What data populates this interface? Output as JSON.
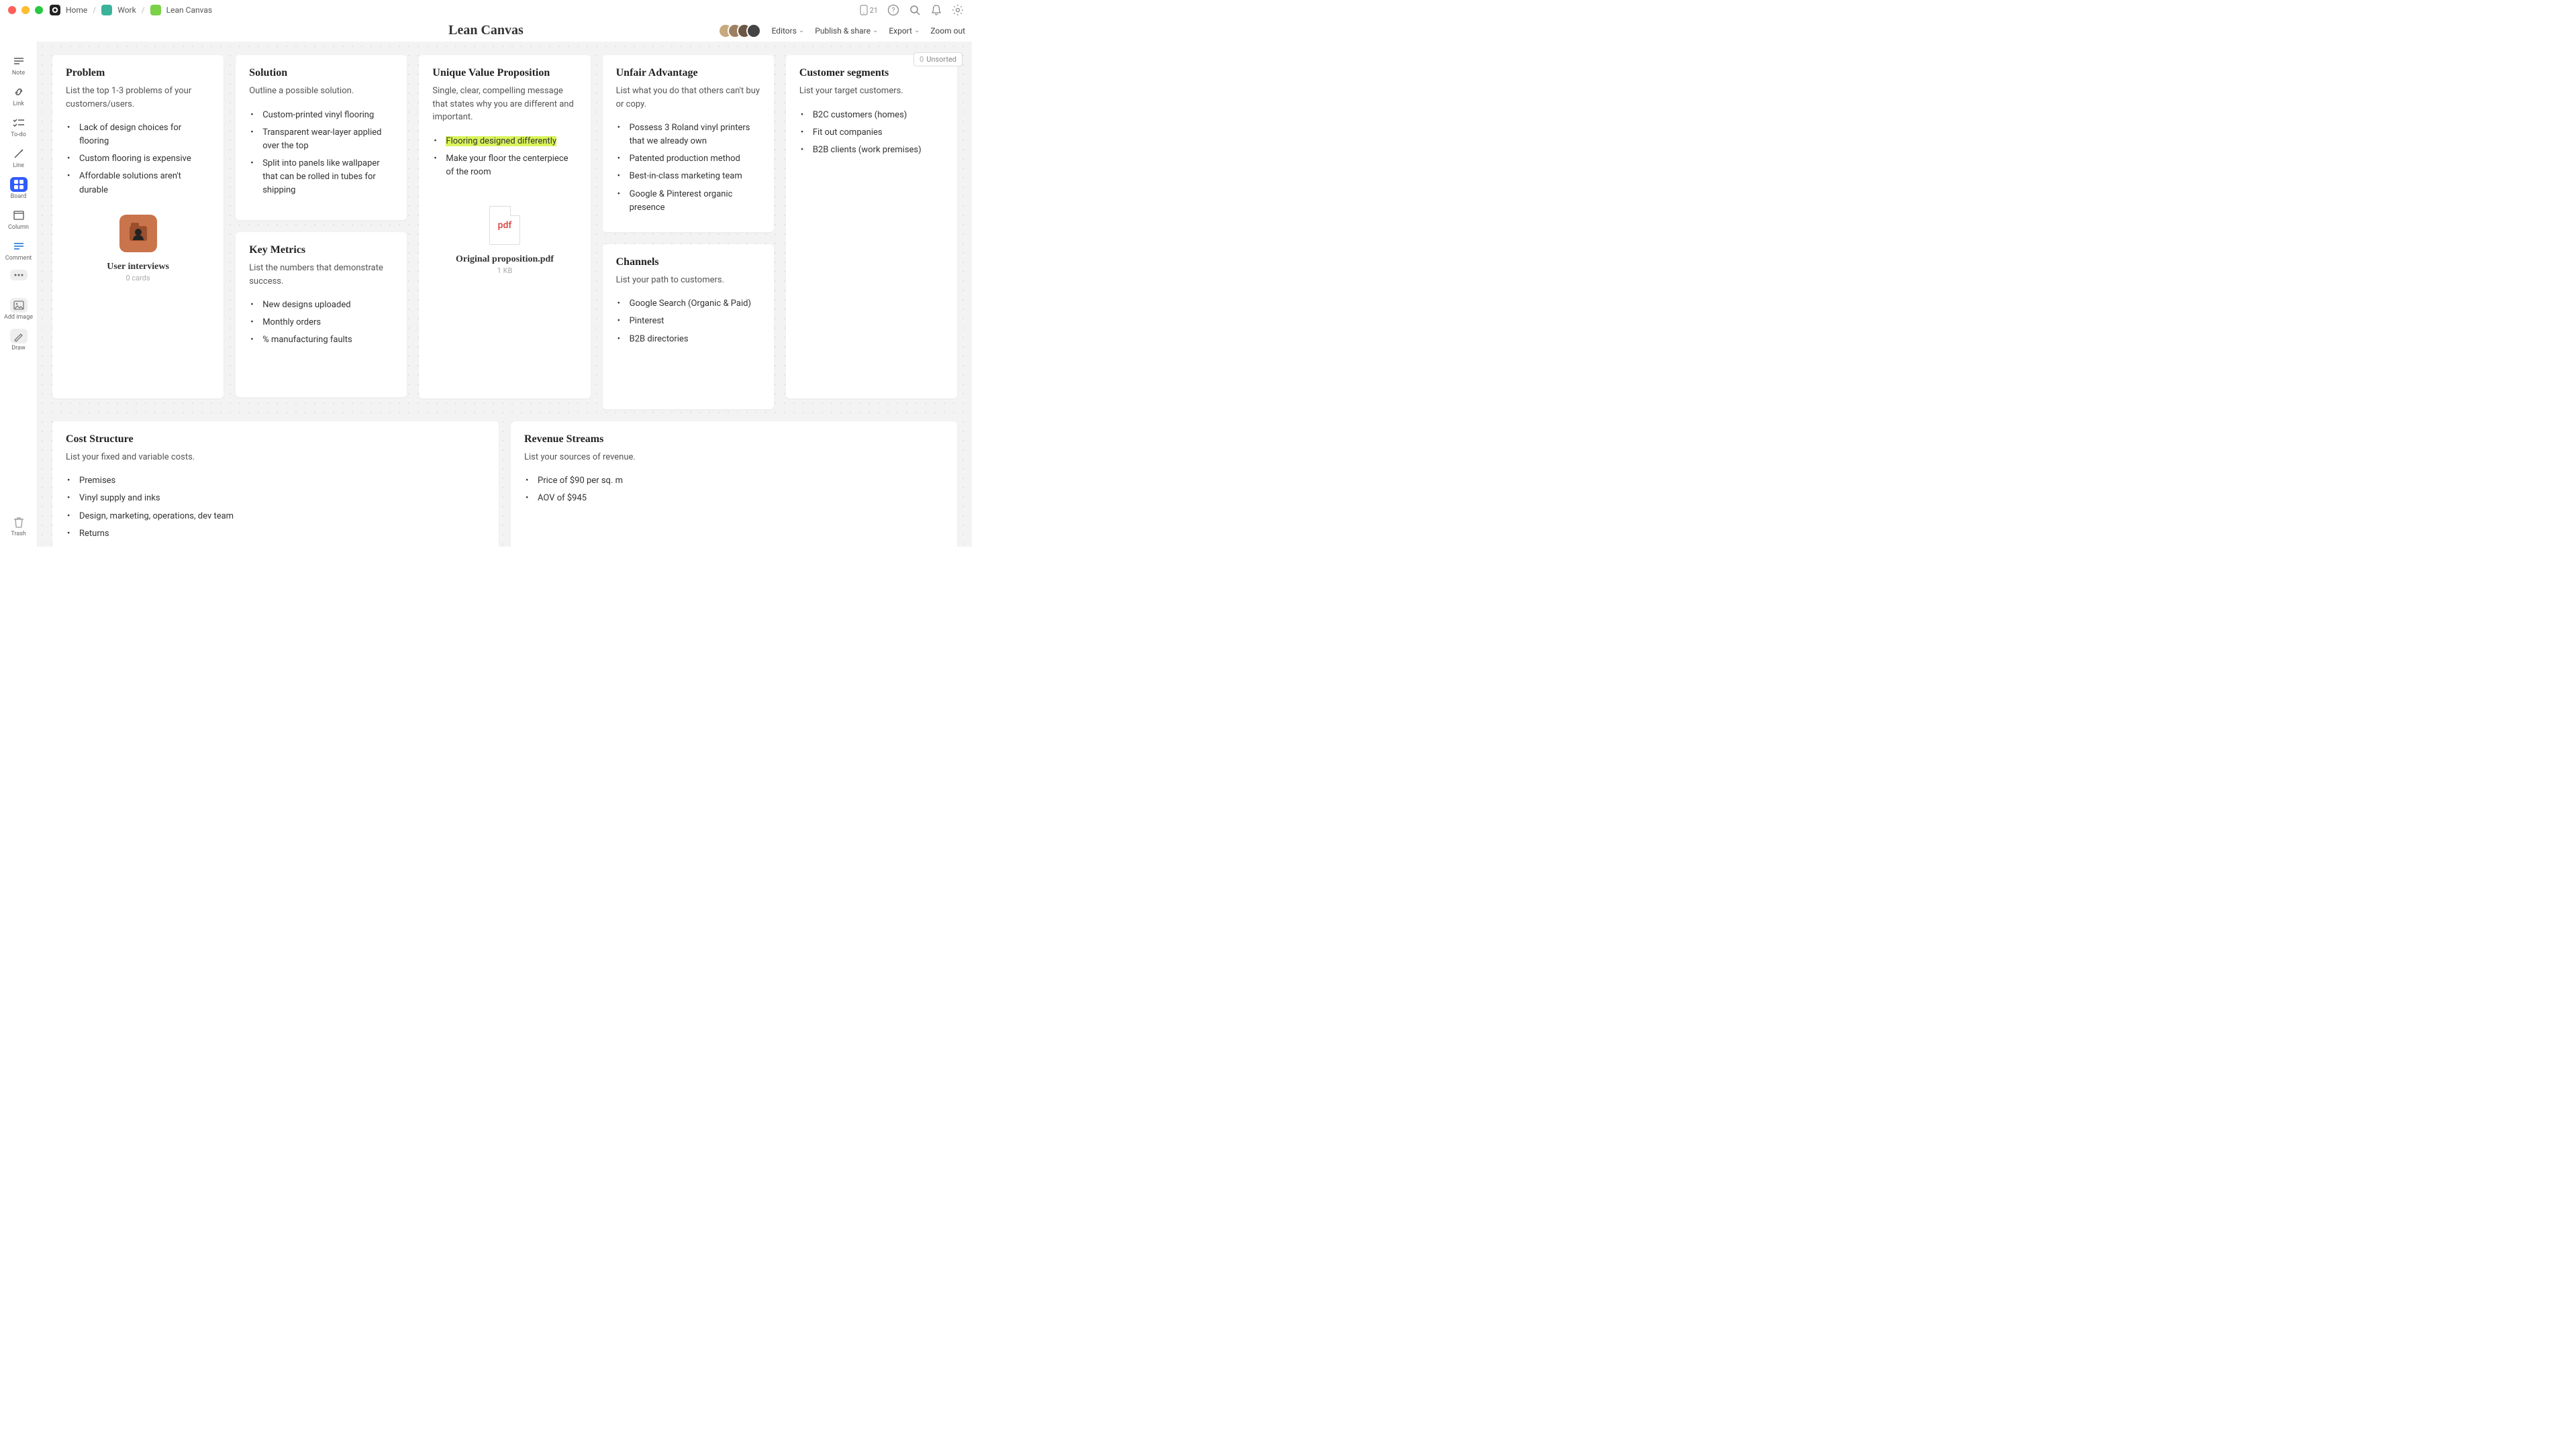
{
  "breadcrumbs": {
    "home": "Home",
    "work": "Work",
    "lean": "Lean Canvas"
  },
  "deviceCount": "21",
  "doc": {
    "title": "Lean Canvas"
  },
  "actions": {
    "editors": "Editors",
    "publish": "Publish & share",
    "export": "Export",
    "zoomout": "Zoom out"
  },
  "sidebar": {
    "note": "Note",
    "link": "Link",
    "todo": "To-do",
    "line": "Line",
    "board": "Board",
    "column": "Column",
    "comment": "Comment",
    "addimage": "Add image",
    "draw": "Draw",
    "trash": "Trash"
  },
  "unsorted": {
    "count": "0",
    "label": "Unsorted"
  },
  "cards": {
    "problem": {
      "title": "Problem",
      "desc": "List the top 1-3 problems of your customers/users.",
      "items": [
        "Lack of design choices for flooring",
        "Custom flooring is expensive",
        "Affordable solutions aren't durable"
      ],
      "embed": {
        "title": "User interviews",
        "meta": "0 cards"
      }
    },
    "solution": {
      "title": "Solution",
      "desc": "Outline a possible solution.",
      "items": [
        "Custom-printed vinyl flooring",
        "Transparent wear-layer applied over the top",
        "Split into panels like wallpaper that can be rolled in tubes for shipping"
      ]
    },
    "metrics": {
      "title": "Key Metrics",
      "desc": "List the numbers that demonstrate success.",
      "items": [
        "New designs uploaded",
        "Monthly orders",
        "% manufacturing faults"
      ]
    },
    "uvp": {
      "title": "Unique Value Proposition",
      "desc": "Single, clear, compelling message that states why you are different and important.",
      "items": [
        {
          "t": "Flooring designed differently",
          "hl": true
        },
        {
          "t": "Make your floor the centerpiece of the room",
          "hl": false
        }
      ],
      "attach": {
        "ext": "pdf",
        "name": "Original proposition.pdf",
        "size": "1 KB"
      }
    },
    "unfair": {
      "title": "Unfair Advantage",
      "desc": "List what you do that others can't buy or copy.",
      "items": [
        "Possess 3 Roland vinyl printers that we already own",
        "Patented production method",
        "Best-in-class marketing team",
        "Google & Pinterest organic presence"
      ]
    },
    "channels": {
      "title": "Channels",
      "desc": "List your path to customers.",
      "items": [
        "Google Search (Organic & Paid)",
        "Pinterest",
        "B2B directories"
      ]
    },
    "segments": {
      "title": "Customer segments",
      "desc": "List your target customers.",
      "items": [
        "B2C customers (homes)",
        "Fit out companies",
        "B2B clients (work premises)"
      ]
    },
    "cost": {
      "title": "Cost Structure",
      "desc": "List your fixed and variable costs.",
      "items": [
        "Premises",
        "Vinyl supply and inks",
        "Design, marketing, operations, dev team",
        "Returns"
      ]
    },
    "revenue": {
      "title": "Revenue Streams",
      "desc": "List your sources of revenue.",
      "items": [
        "Price of $90 per sq. m",
        "AOV of $945"
      ]
    }
  }
}
